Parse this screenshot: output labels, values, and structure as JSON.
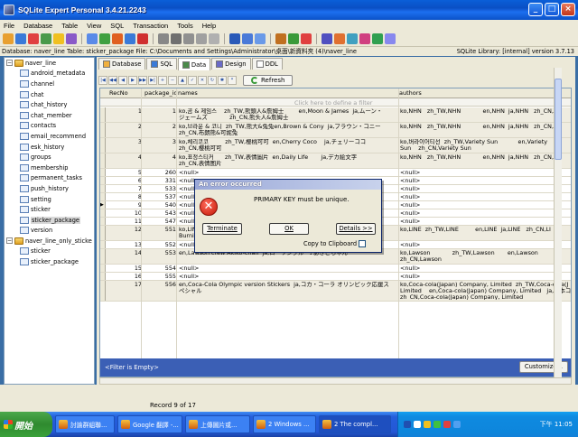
{
  "window": {
    "title": "SQLite Expert Personal 3.4.21.2243",
    "min": "_",
    "max": "□",
    "close": "×"
  },
  "menu": [
    "File",
    "Database",
    "Table",
    "View",
    "SQL",
    "Transaction",
    "Tools",
    "Help"
  ],
  "pathbar": {
    "text": "Database: naver_line   Table: sticker_package   File: C:\\Documents and Settings\\Administrator\\桌面\\新資料夾 (4)\\naver_line",
    "library": "SQLite Library: [internal] version 3.7.13"
  },
  "tree": [
    {
      "kind": "db",
      "label": "naver_line",
      "expander": "−",
      "indent": 0
    },
    {
      "kind": "tbl",
      "label": "android_metadata",
      "indent": 1
    },
    {
      "kind": "tbl",
      "label": "channel",
      "indent": 1
    },
    {
      "kind": "tbl",
      "label": "chat",
      "indent": 1
    },
    {
      "kind": "tbl",
      "label": "chat_history",
      "indent": 1
    },
    {
      "kind": "tbl",
      "label": "chat_member",
      "indent": 1
    },
    {
      "kind": "tbl",
      "label": "contacts",
      "indent": 1
    },
    {
      "kind": "tbl",
      "label": "email_recommend",
      "indent": 1
    },
    {
      "kind": "tbl",
      "label": "esk_history",
      "indent": 1
    },
    {
      "kind": "tbl",
      "label": "groups",
      "indent": 1
    },
    {
      "kind": "tbl",
      "label": "membership",
      "indent": 1
    },
    {
      "kind": "tbl",
      "label": "permanent_tasks",
      "indent": 1
    },
    {
      "kind": "tbl",
      "label": "push_history",
      "indent": 1
    },
    {
      "kind": "tbl",
      "label": "setting",
      "indent": 1
    },
    {
      "kind": "tbl",
      "label": "sticker",
      "indent": 1
    },
    {
      "kind": "tbl",
      "label": "sticker_package",
      "indent": 1,
      "selected": true
    },
    {
      "kind": "tbl",
      "label": "version",
      "indent": 1
    },
    {
      "kind": "db",
      "label": "naver_line_only_sticke",
      "expander": "−",
      "indent": 0
    },
    {
      "kind": "tbl",
      "label": "sticker",
      "indent": 1
    },
    {
      "kind": "tbl",
      "label": "sticker_package",
      "indent": 1
    }
  ],
  "tabs": [
    {
      "label": "Database",
      "color": "#f0b040"
    },
    {
      "label": "SQL",
      "color": "#3a7ad8"
    },
    {
      "label": "Data",
      "color": "#4a8a4a",
      "active": true
    },
    {
      "label": "Design",
      "color": "#6a6ac8"
    },
    {
      "label": "DDL",
      "color": "#ffffff"
    }
  ],
  "navbuttons": [
    "|◀",
    "◀◀",
    "◀",
    "▶",
    "▶▶",
    "▶|",
    "+",
    "−",
    "▲",
    "✓",
    "✕",
    "↻",
    "✱",
    "*"
  ],
  "refresh_label": "Refresh",
  "grid": {
    "headers": [
      "RecNo",
      "package_id",
      "names",
      "authors"
    ],
    "filter_hint": "Click here to define a filter",
    "rows": [
      {
        "recno": "1",
        "pid": "1",
        "names": "ko,곰 & 제임스    zh_TW,熊頭人&詹姆士        en,Moon & James  ja,ムーン・\nジェームズ            zh_CN,熊头人&詹姆士",
        "authors": "ko,NHN   zh_TW,NHN            en,NHN  ja,NHN   zh_CN,N",
        "lines": 2
      },
      {
        "recno": "2",
        "pid": "2",
        "names": "ko,브라운 & 코니  zh_TW,熊大&兔兔en,Brown & Cony  ja,ブラウン・コニー\nzh_CN,布朗熊&可妮兔",
        "authors": "ko,NHN   zh_TW,NHN            en,NHN  ja,NHN   zh_CN,N",
        "lines": 2
      },
      {
        "recno": "3",
        "pid": "3",
        "names": "ko,체리코코         zh_TW,櫻桃可可  en,Cherry Coco    ja,チェリーココ\nzh_CN,樱桃可可",
        "authors": "ko,버라이어티선  zh_TW,Variety Sun           en,Variety\nSun    zh_CN,Variety Sun",
        "lines": 2
      },
      {
        "recno": "4",
        "pid": "4",
        "names": "ko,표정스티커      zh_TW,表情圖片  en,Daily Life       ja,デカ絵文字\nzh_CN,表情图片",
        "authors": "ko,NHN   zh_TW,NHN            en,NHN  ja,NHN   zh_CN,N",
        "lines": 2
      },
      {
        "recno": "5",
        "pid": "260",
        "names": "<null>",
        "authors": "<null>",
        "lines": 1
      },
      {
        "recno": "6",
        "pid": "331",
        "names": "<null>",
        "authors": "<null>",
        "lines": 1
      },
      {
        "recno": "7",
        "pid": "533",
        "names": "<null>",
        "authors": "<null>",
        "lines": 1
      },
      {
        "recno": "8",
        "pid": "537",
        "names": "<null>",
        "authors": "<null>",
        "lines": 1
      },
      {
        "recno": "9",
        "pid": "540",
        "names": "<null>",
        "authors": "<null>",
        "lines": 1,
        "current": true
      },
      {
        "recno": "10",
        "pid": "543",
        "names": "<null>",
        "authors": "<null>",
        "lines": 1
      },
      {
        "recno": "11",
        "pid": "547",
        "names": "<null>",
        "authors": "<null>",
        "lines": 1
      },
      {
        "recno": "12",
        "pid": "551",
        "names": "ko,LIN\nBurnie      zh_CN,LINE Burnie",
        "authors": "ko,LINE  zh_TW,LINE         en,LINE  ja,LINE   zh_CN,LI",
        "lines": 2
      },
      {
        "recno": "13",
        "pid": "552",
        "names": "<null>",
        "authors": "<null>",
        "lines": 1
      },
      {
        "recno": "14",
        "pid": "553",
        "names": "en,Lawson crew Akiko-chan  ja,ローソンクルー♪あきこちゃん",
        "authors": "ko,Lawson            zh_TW,Lawson       en,Lawson\nzh_CN,Lawson",
        "lines": 2
      },
      {
        "recno": "15",
        "pid": "554",
        "names": "<null>",
        "authors": "<null>",
        "lines": 1
      },
      {
        "recno": "16",
        "pid": "555",
        "names": "<null>",
        "authors": "<null>",
        "lines": 1
      },
      {
        "recno": "17",
        "pid": "556",
        "names": "en,Coca-Cola Olympic version Stickers  ja,コカ・コーラ オリンピック応援ス\nペシャル",
        "authors": "ko,Coca-cola(Japan) Company, Limited  zh_TW,Coca-cola(J\nLimited    en,Coca-cola(Japan) Company, Limited   ja,日本コ\nzh_CN,Coca-cola(Japan) Company, Limited",
        "lines": 3
      }
    ]
  },
  "filterbar": {
    "text": "<Filter is Empty>",
    "customize": "Customize..."
  },
  "status": {
    "record": "Record 9 of 17"
  },
  "dialog": {
    "title": "An error occurred",
    "message": "PRIMARY KEY must be unique.",
    "icon_glyph": "✕",
    "buttons": [
      "Terminate",
      "OK",
      "Details >>"
    ],
    "checkbox": "Copy to Clipboard"
  },
  "taskbar": {
    "start": "開始",
    "tasks": [
      "討論群組聯...",
      "Google 翻譯 -...",
      "上傳圖片或...",
      "2 Windows ...",
      "2 The compl..."
    ],
    "clock": "下午 11:05"
  }
}
